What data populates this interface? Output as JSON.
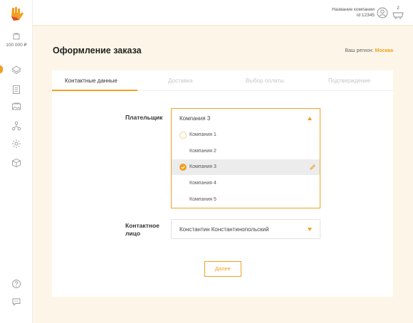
{
  "header": {
    "company_name": "Название компании",
    "company_id": "id 12345",
    "cart_count": "2"
  },
  "sidebar": {
    "wallet_amount": "100 000 ₽"
  },
  "page": {
    "title": "Оформление заказа",
    "region_label": "Ваш регион:",
    "region_value": "Москва"
  },
  "tabs": [
    {
      "label": "Контактные данные",
      "active": true
    },
    {
      "label": "Доставка"
    },
    {
      "label": "Выбор оплаты"
    },
    {
      "label": "Подтверждение"
    }
  ],
  "payer": {
    "label": "Плательщик",
    "value": "Компания 3",
    "options": [
      {
        "label": "Компания 1"
      },
      {
        "label": "Компания 2"
      },
      {
        "label": "Компания 3",
        "selected": true
      },
      {
        "label": "Компания 4"
      },
      {
        "label": "Компания 5"
      }
    ]
  },
  "contact": {
    "label_line1": "Контактное",
    "label_line2": "лицо",
    "value": "Константин Константинопольский"
  },
  "next_button": "Далее",
  "colors": {
    "accent": "#f0a023",
    "background": "#fdf6e8"
  }
}
